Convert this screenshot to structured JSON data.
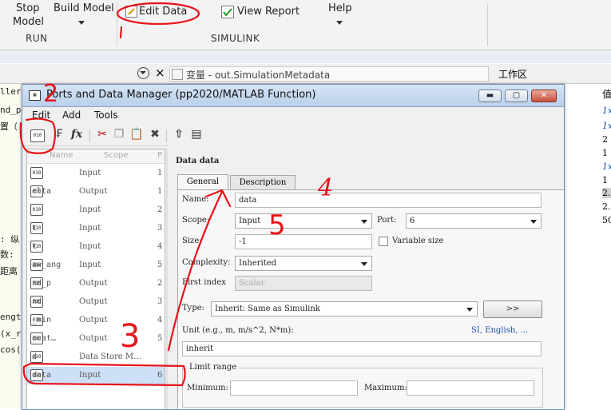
{
  "toolstrip": {
    "stop_label_1": "Stop",
    "stop_label_2": "Model",
    "build_label_1": "Build Model",
    "edit_data_label": "Edit Data",
    "view_report_label": "View Report",
    "help_label": "Help",
    "section_run": "RUN",
    "section_simulink": "SIMULINK"
  },
  "tabbar": {
    "variable_tab": "变量 - out.SimulationMetadata",
    "close_glyph": "×",
    "workspace_label": "工作区"
  },
  "left_code_fragments": [
    "llerE",
    "nd_p",
    "置（",
    ": 纵",
    "数:",
    "距离",
    "engt",
    "(x_r",
    "cos("
  ],
  "right_panel": {
    "header": "值",
    "values": [
      "1x",
      "1x",
      "2",
      "1",
      "1x",
      "1",
      "2.",
      "2.",
      "50"
    ]
  },
  "dialog": {
    "title": "Ports and Data Manager (pp2020/MATLAB Function)",
    "menu": [
      "Edit",
      "Add",
      "Tools"
    ],
    "toolbar_icons": [
      "add-data-icon",
      "add-event-icon",
      "fx-icon",
      "cut-icon",
      "copy-icon",
      "paste-icon",
      "delete-icon",
      "up-arrow-icon",
      "table-icon"
    ],
    "list_header": {
      "name": "Name",
      "scope": "Scope",
      "port": "P"
    },
    "rows": [
      {
        "name": "",
        "scope": "Input",
        "port": "1"
      },
      {
        "name": "elta",
        "scope": "Output",
        "port": "1"
      },
      {
        "name": "",
        "scope": "Input",
        "port": "2"
      },
      {
        "name": "t",
        "scope": "Input",
        "port": "3"
      },
      {
        "name": "t",
        "scope": "Input",
        "port": "4"
      },
      {
        "name": "aw_ang",
        "scope": "Input",
        "port": "5"
      },
      {
        "name": "nd_p",
        "scope": "Output",
        "port": "2"
      },
      {
        "name": "nd",
        "scope": "Output",
        "port": "3"
      },
      {
        "name": "_min",
        "scope": "Output",
        "port": "4"
      },
      {
        "name": "ocat…",
        "scope": "Output",
        "port": "5"
      },
      {
        "name": "d",
        "scope": "Data Store M…",
        "port": ""
      },
      {
        "name": "data",
        "scope": "Input",
        "port": "6"
      }
    ],
    "props": {
      "heading": "Data data",
      "tab_general": "General",
      "tab_description": "Description",
      "name_label": "Name:",
      "name_value": "data",
      "scope_label": "Scope:",
      "scope_value": "Input",
      "port_label": "Port:",
      "port_value": "6",
      "size_label": "Size:",
      "size_value": "-1",
      "variable_size_label": "Variable size",
      "complexity_label": "Complexity:",
      "complexity_value": "Inherited",
      "first_index_label": "First index",
      "first_index_value": "Scalar",
      "type_label": "Type:",
      "type_value": "Inherit: Same as Simulink",
      "type_button": ">>",
      "unit_label": "Unit (e.g., m, m/s^2, N*m):",
      "unit_links": "SI, English, ...",
      "unit_value": "inherit",
      "limit_range_label": "Limit range",
      "minimum_label": "Minimum:",
      "maximum_label": "Maximum:"
    }
  },
  "annotations": {
    "n2": "2",
    "n3": "3",
    "n4": "4",
    "n5": "5"
  },
  "colors": {
    "annotation": "#e8131a",
    "title_gradient": "#c6d9f0",
    "selection": "#cde0f7"
  }
}
